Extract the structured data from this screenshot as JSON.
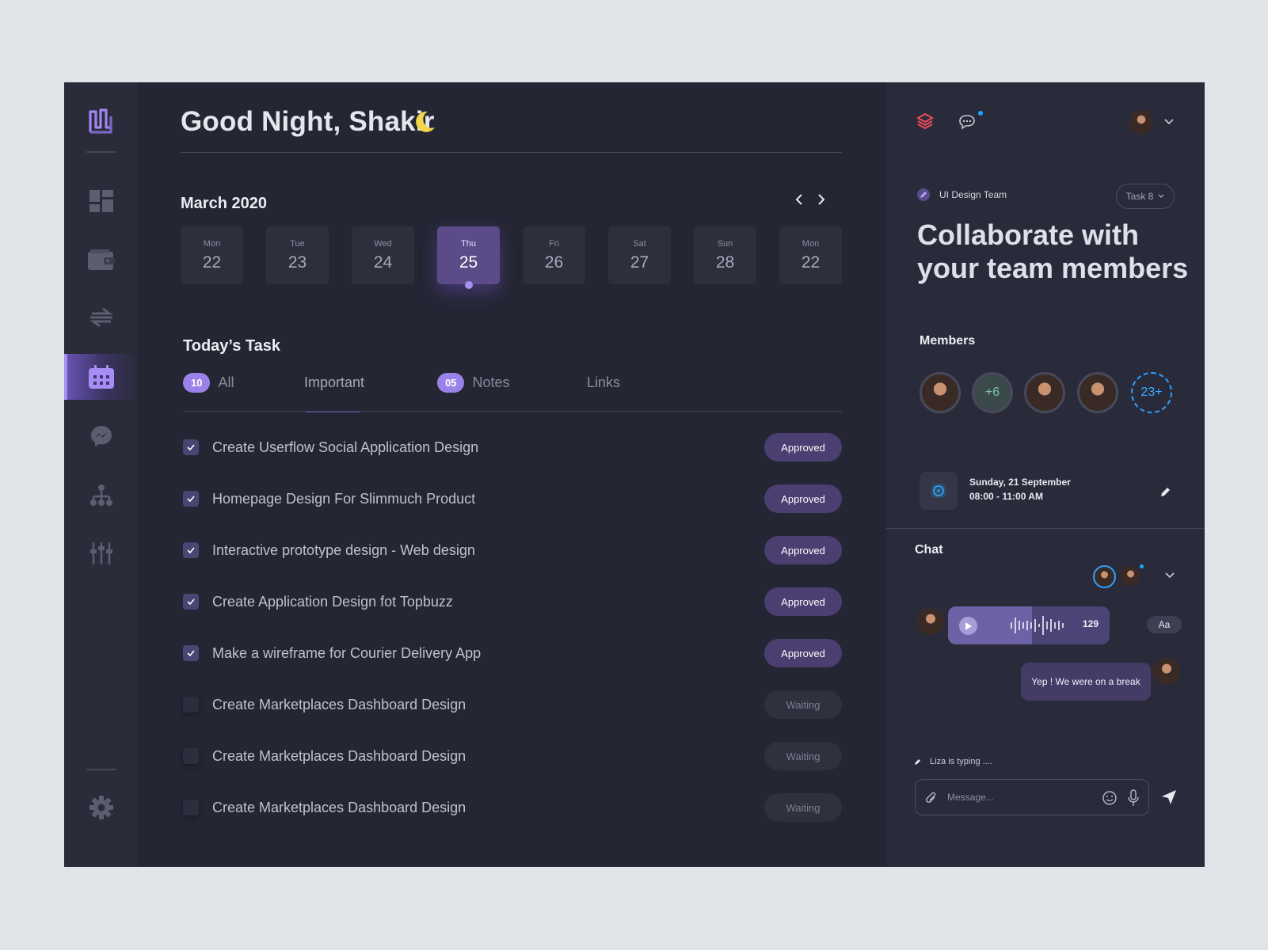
{
  "colors": {
    "accent": "#9b82ea",
    "background": "#252634",
    "sidebar": "#2b2c3a",
    "panel": "#2a2b3a",
    "link": "#2fa0ff"
  },
  "sidebar": {
    "items": [
      {
        "icon": "dashboard-icon"
      },
      {
        "icon": "wallet-icon"
      },
      {
        "icon": "transfer-icon"
      },
      {
        "icon": "calendar-icon",
        "active": true
      },
      {
        "icon": "messenger-icon"
      },
      {
        "icon": "hierarchy-icon"
      },
      {
        "icon": "sliders-icon"
      }
    ],
    "settings_icon": "gear-icon"
  },
  "header": {
    "greeting": "Good Night, Shakir",
    "icon": "moon-icon"
  },
  "calendar": {
    "month": "March 2020",
    "days": [
      {
        "name": "Mon",
        "date": "22"
      },
      {
        "name": "Tue",
        "date": "23"
      },
      {
        "name": "Wed",
        "date": "24"
      },
      {
        "name": "Thu",
        "date": "25",
        "selected": true
      },
      {
        "name": "Fri",
        "date": "26"
      },
      {
        "name": "Sat",
        "date": "27"
      },
      {
        "name": "Sun",
        "date": "28"
      },
      {
        "name": "Mon",
        "date": "22"
      }
    ]
  },
  "tasks": {
    "title": "Today’s Task",
    "tabs": [
      {
        "count": "10",
        "label": "All"
      },
      {
        "label": "Important",
        "active": true
      },
      {
        "count": "05",
        "label": "Notes"
      },
      {
        "label": "Links"
      }
    ],
    "items": [
      {
        "label": "Create Userflow Social Application Design",
        "status": "Approved",
        "checked": true
      },
      {
        "label": "Homepage Design For Slimmuch Product",
        "status": "Approved",
        "checked": true
      },
      {
        "label": "Interactive prototype design - Web design",
        "status": "Approved",
        "checked": true
      },
      {
        "label": "Create Application Design fot Topbuzz",
        "status": "Approved",
        "checked": true
      },
      {
        "label": "Make a wireframe for Courier Delivery App",
        "status": "Approved",
        "checked": true
      },
      {
        "label": "Create Marketplaces Dashboard Design",
        "status": "Waiting",
        "checked": false
      },
      {
        "label": "Create Marketplaces Dashboard Design",
        "status": "Waiting",
        "checked": false
      },
      {
        "label": "Create Marketplaces Dashboard Design",
        "status": "Waiting",
        "checked": false
      }
    ]
  },
  "panel": {
    "team_label": "UI Design Team",
    "task_chip": "Task 8",
    "headline": "Collaborate with your team members",
    "members_title": "Members",
    "members_plus": "+6",
    "members_more": "23+",
    "event_date": "Sunday, 21 September",
    "event_time": "08:00 - 11:00 AM"
  },
  "chat": {
    "title": "Chat",
    "voice_length": "129",
    "format_button": "Aa",
    "message": "Yep ! We were on a break",
    "typing": "Liza is typing ....",
    "input_placeholder": "Message..."
  }
}
